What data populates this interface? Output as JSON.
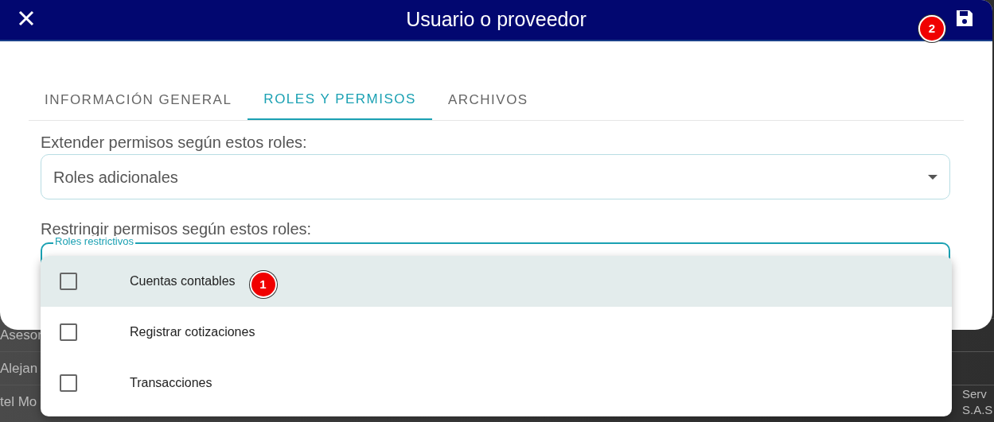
{
  "background_rows": [
    {
      "column_1": "Asesor"
    },
    {
      "column_1": "Alejan"
    },
    {
      "column_1": "tel Mo",
      "column_2": "Serv",
      "column_3": "S.A.S"
    }
  ],
  "dialog": {
    "title": "Usuario o proveedor",
    "badge": "2"
  },
  "tabs": [
    {
      "label": "INFORMACIÓN GENERAL",
      "selected": false
    },
    {
      "label": "ROLES Y PERMISOS",
      "selected": true
    },
    {
      "label": "ARCHIVOS",
      "selected": false
    }
  ],
  "extend": {
    "label": "Extender permisos según estos roles:",
    "placeholder": "Roles adicionales"
  },
  "restrict": {
    "label": "Restringir permisos según estos roles:",
    "field_label": "Roles restrictivos",
    "focused": true
  },
  "menu": [
    {
      "label": "Cuentas contables",
      "checked": false,
      "highlighted": true,
      "badge": "1"
    },
    {
      "label": "Registrar cotizaciones",
      "checked": false,
      "highlighted": false
    },
    {
      "label": "Transacciones",
      "checked": false,
      "highlighted": false
    }
  ]
}
